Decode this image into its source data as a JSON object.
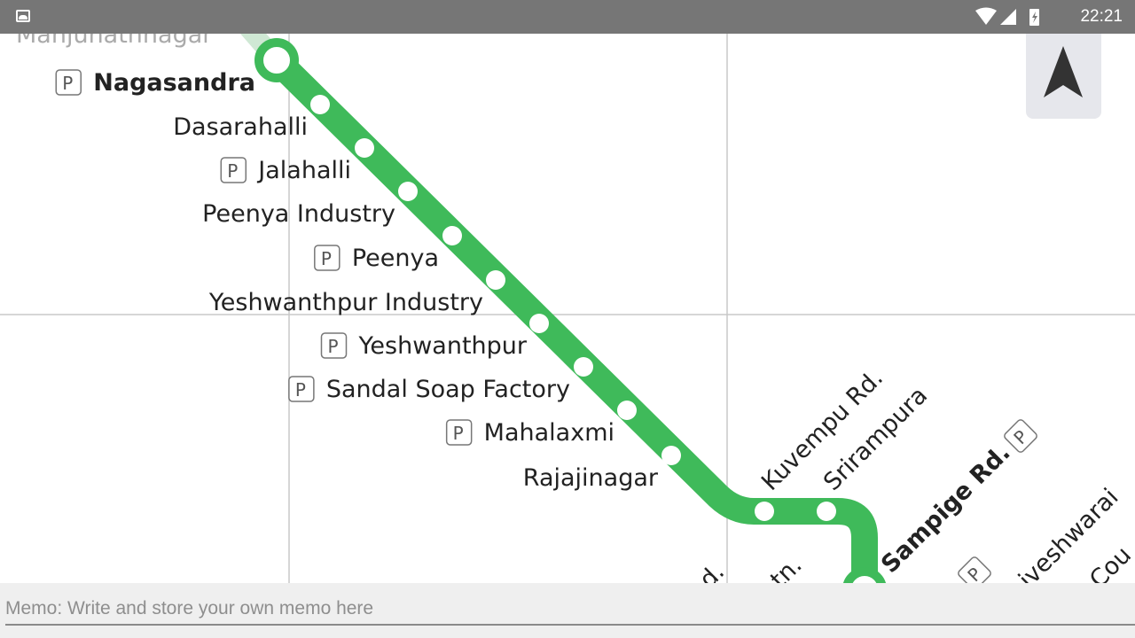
{
  "status_bar": {
    "time": "22:21",
    "icons": [
      "gallery-icon",
      "wifi-icon",
      "signal-icon",
      "battery-charging-icon"
    ]
  },
  "map": {
    "line_color": "#3fba5a",
    "parking_label": "P",
    "faded_station": "Manjunathnagar",
    "stations": [
      {
        "name": "Nagasandra",
        "parking": true,
        "bold": true
      },
      {
        "name": "Dasarahalli",
        "parking": false
      },
      {
        "name": "Jalahalli",
        "parking": true
      },
      {
        "name": "Peenya Industry",
        "parking": false
      },
      {
        "name": "Peenya",
        "parking": true
      },
      {
        "name": "Yeshwanthpur Industry",
        "parking": false
      },
      {
        "name": "Yeshwanthpur",
        "parking": true
      },
      {
        "name": "Sandal Soap Factory",
        "parking": true
      },
      {
        "name": "Mahalaxmi",
        "parking": true
      },
      {
        "name": "Rajajinagar",
        "parking": false
      },
      {
        "name": "Kuvempu Rd.",
        "parking": false
      },
      {
        "name": "Srirampura",
        "parking": false
      },
      {
        "name": "Sampige Rd.",
        "parking": true,
        "bold": true
      }
    ],
    "partial_labels": [
      "...d.",
      "...tn.",
      "...iveshwarai...",
      "...Cou..."
    ]
  },
  "compass": {
    "icon": "north-arrow-icon"
  },
  "memo": {
    "placeholder": "Memo: Write and store your own memo here",
    "value": ""
  }
}
